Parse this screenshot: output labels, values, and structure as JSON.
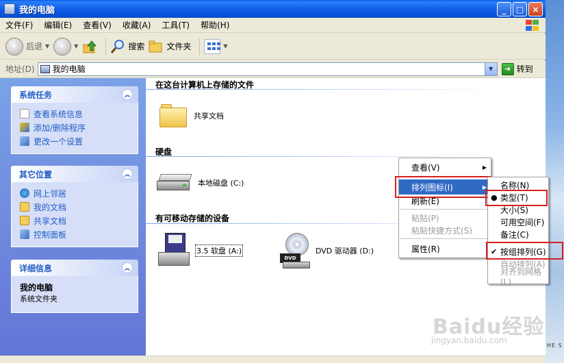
{
  "window": {
    "title": "我的电脑"
  },
  "menubar": [
    "文件(F)",
    "编辑(E)",
    "查看(V)",
    "收藏(A)",
    "工具(T)",
    "帮助(H)"
  ],
  "toolbar": {
    "back_label": "后退",
    "search_label": "搜索",
    "folders_label": "文件夹"
  },
  "address": {
    "label": "地址(D)",
    "value": "我的电脑",
    "go_label": "转到"
  },
  "tasks": {
    "system": {
      "title": "系统任务",
      "items": [
        "查看系统信息",
        "添加/删除程序",
        "更改一个设置"
      ]
    },
    "places": {
      "title": "其它位置",
      "items": [
        "网上邻居",
        "我的文档",
        "共享文档",
        "控制面板"
      ]
    },
    "details": {
      "title": "详细信息",
      "name": "我的电脑",
      "subtitle": "系统文件夹"
    }
  },
  "groups": [
    {
      "title": "在这台计算机上存储的文件",
      "items": [
        "共享文档"
      ]
    },
    {
      "title": "硬盘",
      "items": [
        "本地磁盘 (C:)"
      ]
    },
    {
      "title": "有可移动存储的设备",
      "items": [
        "3.5 软盘 (A:)",
        "DVD 驱动器 (D:)"
      ]
    }
  ],
  "context_menu": {
    "items": [
      "查看(V)",
      "排列图标(I)",
      "刷新(E)",
      "粘贴(P)",
      "粘贴快捷方式(S)",
      "属性(R)"
    ],
    "highlighted": "排列图标(I)"
  },
  "submenu": {
    "items": [
      "名称(N)",
      "类型(T)",
      "大小(S)",
      "可用空间(F)",
      "备注(C)",
      "按组排列(G)",
      "自动排列(A)",
      "对齐到网格(L)"
    ],
    "selected_radio": "类型(T)",
    "checked": "按组排列(G)"
  },
  "watermark": {
    "brand": "Baidu经验",
    "url": "jingyan.baidu.com"
  },
  "edge_text": "HE S",
  "colors": {
    "accent": "#316ac5",
    "title_blue": "#0552d6",
    "highlight_box": "#d81e1e",
    "task_text": "#215dc6"
  }
}
